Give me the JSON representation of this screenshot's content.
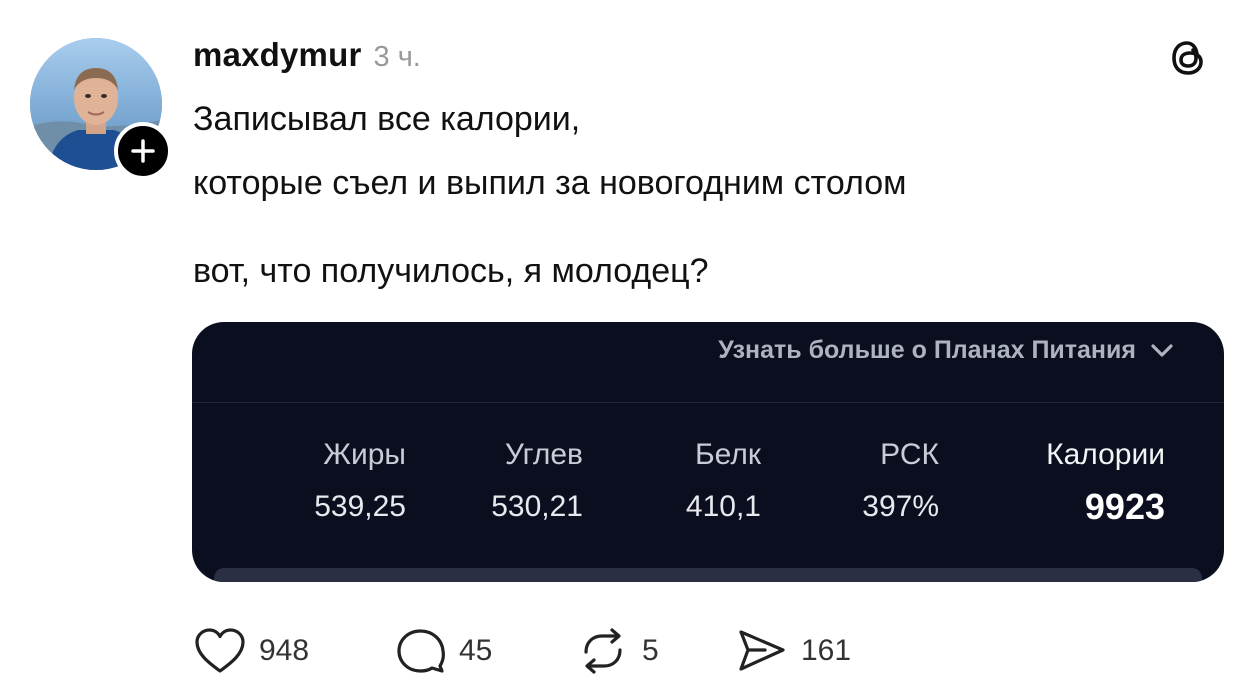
{
  "author": {
    "username": "maxdymur",
    "time": "3 ч.",
    "avatar_icon": "user-photo-avatar",
    "follow_icon": "plus-icon"
  },
  "app_icon": "threads-logo-icon",
  "post": {
    "line1": "Записывал все калории,",
    "line2": "которые съел и выпил за новогодним столом",
    "line3": "вот, что получилось, я молодец?"
  },
  "card": {
    "link_label": "Узнать больше о Планах Питания",
    "link_icon": "chevron-down-icon",
    "stats": [
      {
        "label": "Жиры",
        "value": "539,25"
      },
      {
        "label": "Углев",
        "value": "530,21"
      },
      {
        "label": "Белк",
        "value": "410,1"
      },
      {
        "label": "РСК",
        "value": "397%"
      },
      {
        "label": "Калории",
        "value": "9923"
      }
    ],
    "colors": {
      "background": "#0b0e1e",
      "text": "#e8e9ee",
      "muted": "#aeb3c2"
    }
  },
  "actions": {
    "likes": "948",
    "comments": "45",
    "reposts": "5",
    "shares": "161",
    "icons": [
      "heart-icon",
      "comment-icon",
      "repost-icon",
      "share-icon"
    ]
  }
}
